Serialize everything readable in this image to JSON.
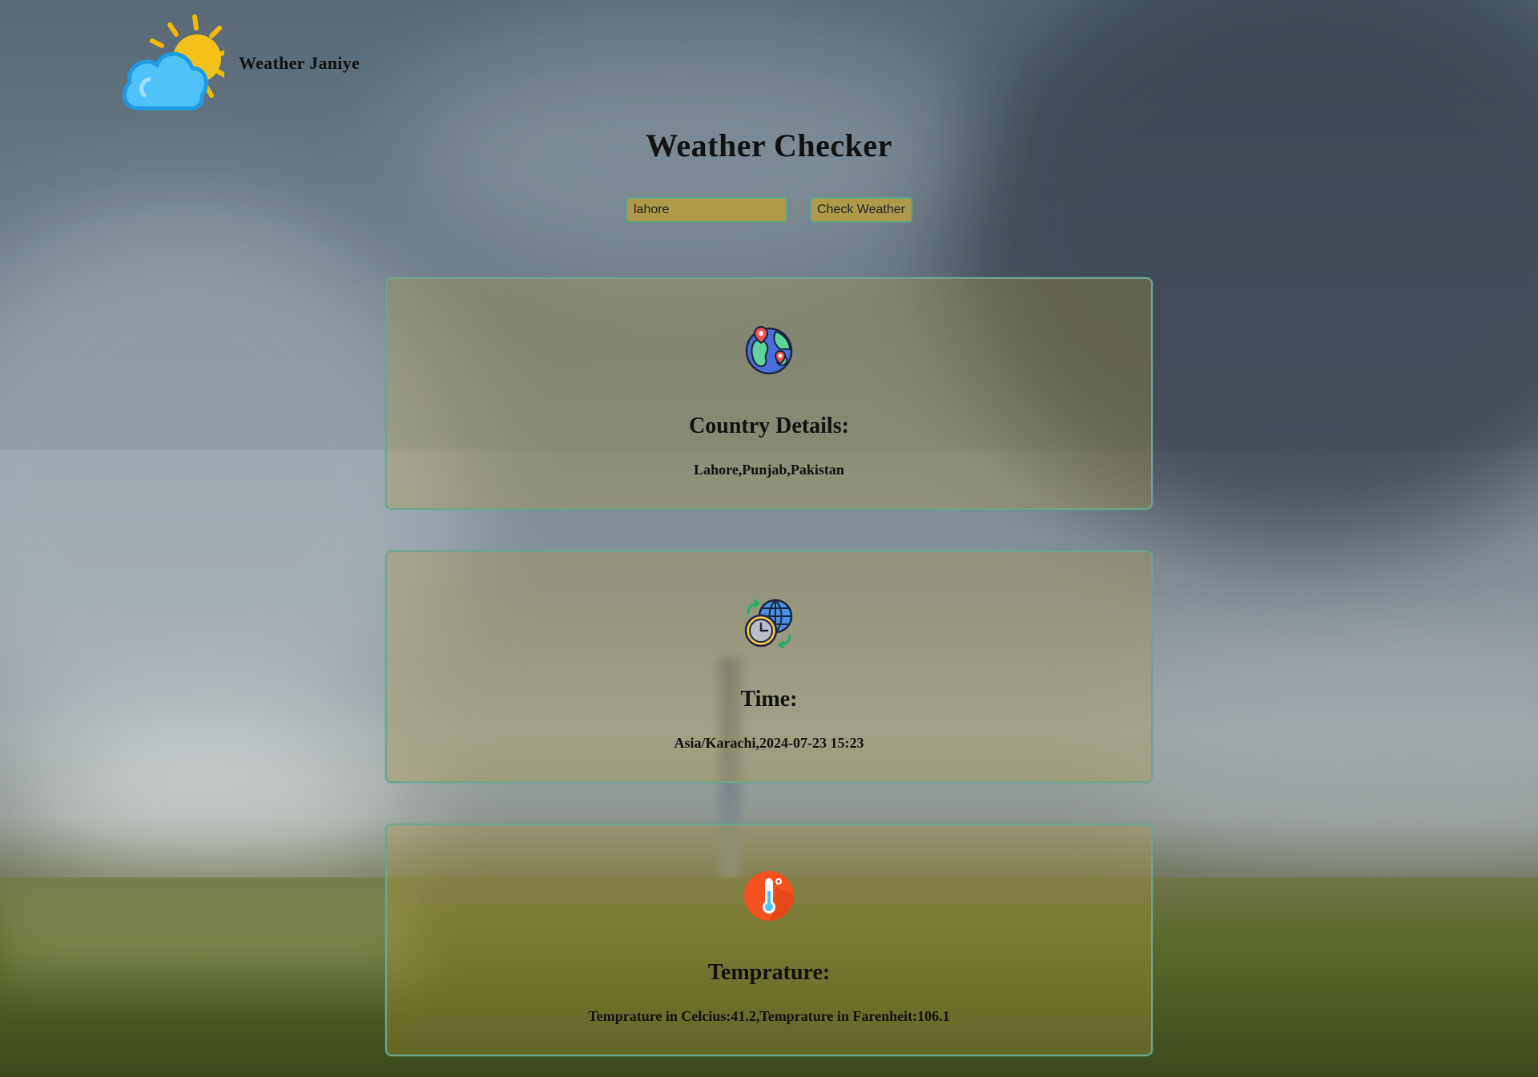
{
  "header": {
    "brand": "Weather Janiye",
    "logo_icon": "sun-behind-cloud-icon"
  },
  "page": {
    "title": "Weather Checker"
  },
  "search": {
    "value": "lahore",
    "placeholder": "",
    "button_label": "Check Weather"
  },
  "cards": {
    "country": {
      "icon": "globe-location-icon",
      "heading": "Country Details:",
      "value": "Lahore,Punjab,Pakistan"
    },
    "time": {
      "icon": "world-clock-icon",
      "heading": "Time:",
      "value": "Asia/Karachi,2024-07-23 15:23"
    },
    "temperature": {
      "icon": "thermometer-icon",
      "heading": "Temprature:",
      "value": "Temprature in Celcius:41.2,Temprature in Farenheit:106.1"
    }
  },
  "colors": {
    "control_fill": "#b09a4a",
    "control_border": "#5aa58f",
    "card_border": "#6fa58f"
  }
}
